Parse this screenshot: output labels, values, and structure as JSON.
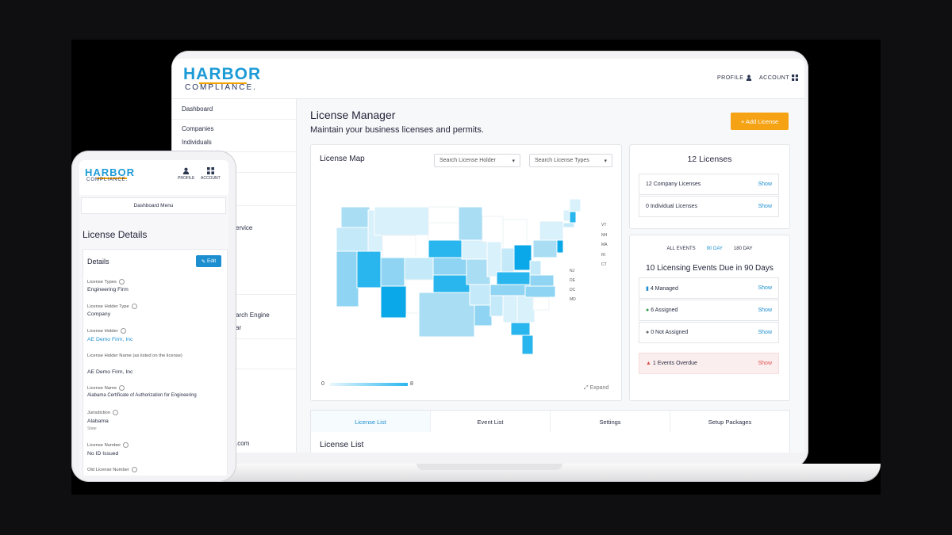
{
  "laptop": {
    "logo": {
      "top": "HARBOR",
      "bottom": "COMPLIANCE."
    },
    "header": {
      "profile_label": "PROFILE",
      "account_label": "ACCOUNT"
    },
    "sidebar": {
      "items": [
        "Dashboard",
        "Companies",
        "Individuals"
      ],
      "partial_items": [
        "ervice",
        "arch Engine",
        "ar",
        ".com"
      ]
    },
    "page": {
      "title": "License Manager",
      "subtitle": "Maintain your business licenses and permits.",
      "add_button": "+ Add License"
    },
    "map": {
      "title": "License Map",
      "dropdown_holder": "Search License Holder",
      "dropdown_types": "Search License Types",
      "legend_min": "0",
      "legend_max": "8",
      "expand_label": "Expand",
      "small_state_labels": [
        "VT",
        "NH",
        "MA",
        "RI",
        "CT",
        "NJ",
        "DE",
        "DC",
        "MD"
      ],
      "colors": {
        "low": "#d9f1fb",
        "mid": "#8fd4f2",
        "high": "#29b6ee",
        "max": "#0aa7e9"
      }
    },
    "licenses": {
      "title": "12 Licenses",
      "rows": [
        {
          "label": "12 Company Licenses",
          "action": "Show"
        },
        {
          "label": "0 Individual Licenses",
          "action": "Show"
        }
      ]
    },
    "events": {
      "tabs": [
        "ALL EVENTS",
        "90 DAY",
        "180 DAY"
      ],
      "active_tab": "90 DAY",
      "title": "10 Licensing Events Due in 90 Days",
      "rows": [
        {
          "label": "4 Managed",
          "action": "Show",
          "icon": "building-icon"
        },
        {
          "label": "6 Assigned",
          "action": "Show",
          "icon": "user-icon"
        },
        {
          "label": "0 Not Assigned",
          "action": "Show",
          "icon": "user-x-icon"
        },
        {
          "label": "1 Events Overdue",
          "action": "Show",
          "icon": "warning-icon"
        }
      ]
    },
    "bottom_tabs": [
      "License List",
      "Event List",
      "Settings",
      "Setup Packages"
    ],
    "active_bottom_tab": "License List",
    "list_title": "License List"
  },
  "phone": {
    "logo": {
      "top": "HARBOR",
      "bottom": "COMPLIANCE."
    },
    "profile_label": "PROFILE",
    "account_label": "ACCOUNT",
    "menu_label": "Dashboard Menu",
    "title": "License Details",
    "card_title": "Details",
    "edit_label": "Edit",
    "fields": {
      "license_types": {
        "label": "License Types",
        "value": "Engineering Firm"
      },
      "holder_type": {
        "label": "License Holder Type",
        "value": "Company"
      },
      "holder": {
        "label": "License Holder",
        "value": "AE Demo Firm, Inc"
      },
      "holder_name": {
        "label": "License Holder Name (as listed on the license)",
        "value": "AE Demo Firm, Inc"
      },
      "license_name": {
        "label": "License Name",
        "value": "Alabama Certificate of Authorization for Engineering"
      },
      "jurisdiction": {
        "label": "Jurisdiction",
        "value": "Alabama",
        "sub": "State"
      },
      "license_number": {
        "label": "License Number",
        "value": "No ID Issued"
      },
      "old_license_number": {
        "label": "Old License Number"
      }
    }
  }
}
